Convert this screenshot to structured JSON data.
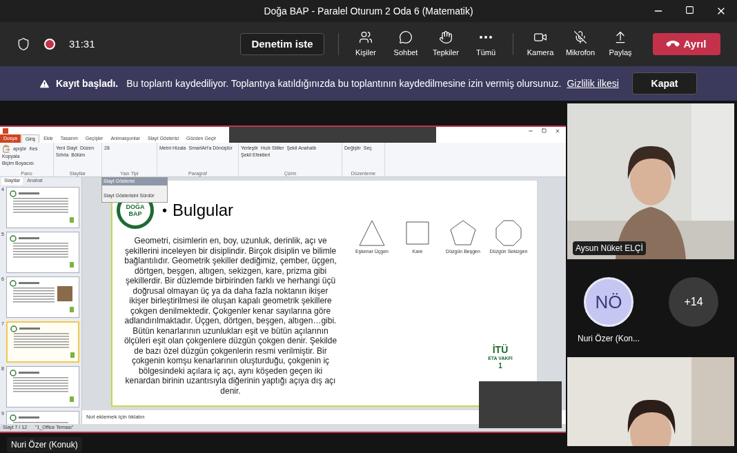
{
  "window": {
    "title": "Doğa BAP - Paralel Oturum 2 Oda 6 (Matematik)"
  },
  "meeting_bar": {
    "recording": true,
    "timer": "31:31",
    "help_button": "Denetim iste",
    "actions": [
      {
        "kind": "people",
        "label": "Kişiler"
      },
      {
        "kind": "chat",
        "label": "Sohbet"
      },
      {
        "kind": "reactions",
        "label": "Tepkiler"
      },
      {
        "kind": "more",
        "label": "Tümü"
      },
      {
        "kind": "camera",
        "label": "Kamera"
      },
      {
        "kind": "mic",
        "label": "Mikrofon",
        "muted": true
      },
      {
        "kind": "share",
        "label": "Paylaş"
      }
    ],
    "leave_button": "Ayrıl"
  },
  "banner": {
    "title": "Kayıt başladı.",
    "message": "Bu toplantı kaydediliyor. Toplantıya katıldığınızda bu toplantının kaydedilmesine izin vermiş olursunuz.",
    "link": "Gizlilik ilkesi",
    "close_button": "Kapat"
  },
  "shared_screen": {
    "presenter": "Nuri Özer (Konuk)",
    "ribbon_tabs": [
      {
        "label": "Dosya",
        "kind": "file",
        "selected": false
      },
      {
        "label": "Giriş",
        "selected": true
      },
      {
        "label": "Ekle",
        "selected": false
      },
      {
        "label": "Tasarım",
        "selected": false
      },
      {
        "label": "Geçişler",
        "selected": false
      },
      {
        "label": "Animasyonlar",
        "selected": false
      },
      {
        "label": "Slayt Gösterisi",
        "selected": false
      },
      {
        "label": "Gözden Geçir",
        "selected": false
      }
    ],
    "ribbon_groups": [
      {
        "label": "Pano",
        "items": [
          "apıştır",
          "Kes",
          "Kopyala",
          "Biçim Boyacısı"
        ]
      },
      {
        "label": "Slaytlar",
        "items": [
          "Yeni Slayt",
          "Düzen",
          "Sıfırla",
          "Bölüm"
        ]
      },
      {
        "label": "Yazı Tipi",
        "items": [
          "28"
        ]
      },
      {
        "label": "Paragraf",
        "items": [
          "Metni Hizala",
          "SmartArt'a Dönüştür"
        ]
      },
      {
        "label": "Çizim",
        "items": [
          "Yerleştir",
          "Hızlı Stiller",
          "Şekil Anahattı",
          "Şekil Efektleri"
        ]
      },
      {
        "label": "Düzenleme",
        "items": [
          "Değiştir",
          "Seç"
        ]
      }
    ],
    "panel_tabs": [
      {
        "label": "Slaytlar",
        "selected": true
      },
      {
        "label": "Anahat",
        "selected": false
      }
    ],
    "thumbnails": [
      {
        "number": "4",
        "selected": false
      },
      {
        "number": "5",
        "selected": false
      },
      {
        "number": "6",
        "selected": false
      },
      {
        "number": "7",
        "selected": true
      },
      {
        "number": "8",
        "selected": false
      },
      {
        "number": "9",
        "selected": false
      }
    ],
    "slideshow_popup": {
      "title": "Slayt Gösterisi",
      "button": "Slayt Gösterisini Sürdür"
    },
    "slide": {
      "logo": [
        "DOĞA",
        "BAP"
      ],
      "bullet": "•",
      "title": "Bulgular",
      "body": "Geometri, cisimlerin en, boy, uzunluk, derinlik, açı ve şekillerini inceleyen bir disiplindir. Birçok disiplin ve bilimle bağlantılıdır. Geometrik şekiller dediğimiz, çember, üçgen, dörtgen, beşgen, altıgen, sekizgen, kare, prizma gibi şekillerdir. Bir düzlemde birbirinden farklı ve herhangi üçü doğrusal olmayan üç ya da daha fazla noktanın ikişer ikişer birleştirilmesi ile oluşan kapalı geometrik şekillere çokgen denilmektedir. Çokgenler kenar sayılarına göre adlandırılmaktadır. Üçgen, dörtgen, beşgen, altıgen…gibi. Bütün kenarlarının uzunlukları eşit ve bütün açılarının ölçüleri eşit olan çokgenlere düzgün çokgen denir. Şekilde de bazı özel düzgün çokgenlerin resmi verilmiştir. Bir çokgenin komşu kenarlarının oluşturduğu, çokgenin iç bölgesindeki açılara iç açı, aynı köşeden geçen iki kenardan birinin uzantısıyla diğerinin yaptığı açıya dış açı denir.",
      "shapes": [
        {
          "kind": "triangle",
          "caption": "Eşkenar Üçgen"
        },
        {
          "kind": "square",
          "caption": "Kare"
        },
        {
          "kind": "pentagon",
          "caption": "Düzgün Beşgen"
        },
        {
          "kind": "octagon",
          "caption": "Düzgün Sekizgen"
        }
      ],
      "sponsor": {
        "name": "İTÜ",
        "subtitle": "ETA VAKFI",
        "mark": "1"
      }
    },
    "notes_placeholder": "Not eklemek için tıklatın",
    "status": [
      "Slayt 7 / 12",
      "\"1_Office Teması\""
    ]
  },
  "participants": [
    {
      "kind": "video",
      "name": "Aysun Nüket ELÇİ"
    },
    {
      "kind": "avatar",
      "initials": "NÖ",
      "name": "Nuri Özer (Kon..."
    },
    {
      "kind": "overflow",
      "count": "+14"
    },
    {
      "kind": "video"
    }
  ]
}
